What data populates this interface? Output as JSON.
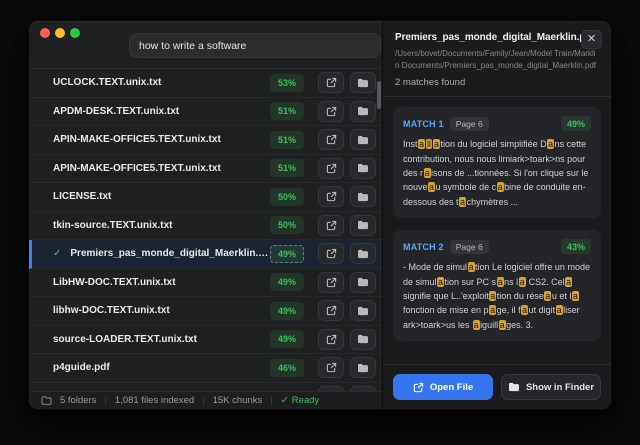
{
  "titlebar": {
    "search_value": "how to write a software"
  },
  "file_list": [
    {
      "name": "UCLOCK.TEXT.unix.txt",
      "score": "53%"
    },
    {
      "name": "APDM-DESK.TEXT.unix.txt",
      "score": "51%"
    },
    {
      "name": "APIN-MAKE-OFFICE5.TEXT.unix.txt",
      "score": "51%"
    },
    {
      "name": "APIN-MAKE-OFFICE5.TEXT.unix.txt",
      "score": "51%"
    },
    {
      "name": "LICENSE.txt",
      "score": "50%"
    },
    {
      "name": "tkin-source.TEXT.unix.txt",
      "score": "50%"
    },
    {
      "name": "Premiers_pas_monde_digital_Maerklin.pdf",
      "score": "49%",
      "selected": true
    },
    {
      "name": "LibHW-DOC.TEXT.unix.txt",
      "score": "49%"
    },
    {
      "name": "libhw-DOC.TEXT.unix.txt",
      "score": "49%"
    },
    {
      "name": "source-LOADER.TEXT.unix.txt",
      "score": "49%"
    },
    {
      "name": "p4guide.pdf",
      "score": "46%"
    }
  ],
  "status_bar": {
    "folders": "5 folders",
    "files_indexed": "1,081 files indexed",
    "chunks": "15K chunks",
    "ready_check": "✓",
    "ready": "Ready"
  },
  "detail_panel": {
    "title": "Premiers_pas_monde_digital_Maerklin.pdf",
    "close_label": "✕",
    "path": "/Users/bovet/Documents/Family/Jean/Model Train/Marklin Documents/Premiers_pas_monde_digital_Maerklin.pdf",
    "matches_found": "2 matches found",
    "matches": [
      {
        "label": "MATCH 1",
        "page": "Page 6",
        "score": "49%",
        "segments": [
          {
            "t": "Inst"
          },
          {
            "t": "a",
            "h": true
          },
          {
            "t": "ll",
            "h": true
          },
          {
            "t": "a",
            "h": true
          },
          {
            "t": "tion du logiciel simplifiée D"
          },
          {
            "t": "a",
            "h": true
          },
          {
            "t": "ns cette contribution, nous nous limiark>toark>ns pour des r"
          },
          {
            "t": "a",
            "h": true
          },
          {
            "t": "isons de ...tionnées. Si l'on clique sur le nouve"
          },
          {
            "t": "a",
            "h": true
          },
          {
            "t": "u symbole de c"
          },
          {
            "t": "a",
            "h": true
          },
          {
            "t": "bine de conduite en-dessous des t"
          },
          {
            "t": "a",
            "h": true
          },
          {
            "t": "chymètres ..."
          }
        ]
      },
      {
        "label": "MATCH 2",
        "page": "Page 6",
        "score": "43%",
        "segments": [
          {
            "t": "- Mode de simul"
          },
          {
            "t": "a",
            "h": true
          },
          {
            "t": "tion Le logiciel offre un mode de simul"
          },
          {
            "t": "a",
            "h": true
          },
          {
            "t": "tion sur PC s"
          },
          {
            "t": "a",
            "h": true
          },
          {
            "t": "ns l"
          },
          {
            "t": "a",
            "h": true
          },
          {
            "t": " CS2. Cel"
          },
          {
            "t": "a",
            "h": true
          },
          {
            "t": " signifie que L..'exploit"
          },
          {
            "t": "a",
            "h": true
          },
          {
            "t": "tion du rése"
          },
          {
            "t": "a",
            "h": true
          },
          {
            "t": "u et l"
          },
          {
            "t": "a",
            "h": true
          },
          {
            "t": " fonction de mise en p"
          },
          {
            "t": "a",
            "h": true
          },
          {
            "t": "ge, il f"
          },
          {
            "t": "a",
            "h": true
          },
          {
            "t": "ut digit"
          },
          {
            "t": "a",
            "h": true
          },
          {
            "t": "liser ark>toark>us les "
          },
          {
            "t": "a",
            "h": true
          },
          {
            "t": "iguill"
          },
          {
            "t": "a",
            "h": true
          },
          {
            "t": "ges. 3."
          }
        ]
      }
    ],
    "footer": {
      "open_file": "Open File",
      "show_in_finder": "Show in Finder"
    }
  },
  "colors": {
    "accent_blue": "#3674f0",
    "green": "#3fbf5f",
    "highlight": "#d7a02f",
    "match_label": "#58a6ff",
    "selected_border": "#3b82f6"
  }
}
